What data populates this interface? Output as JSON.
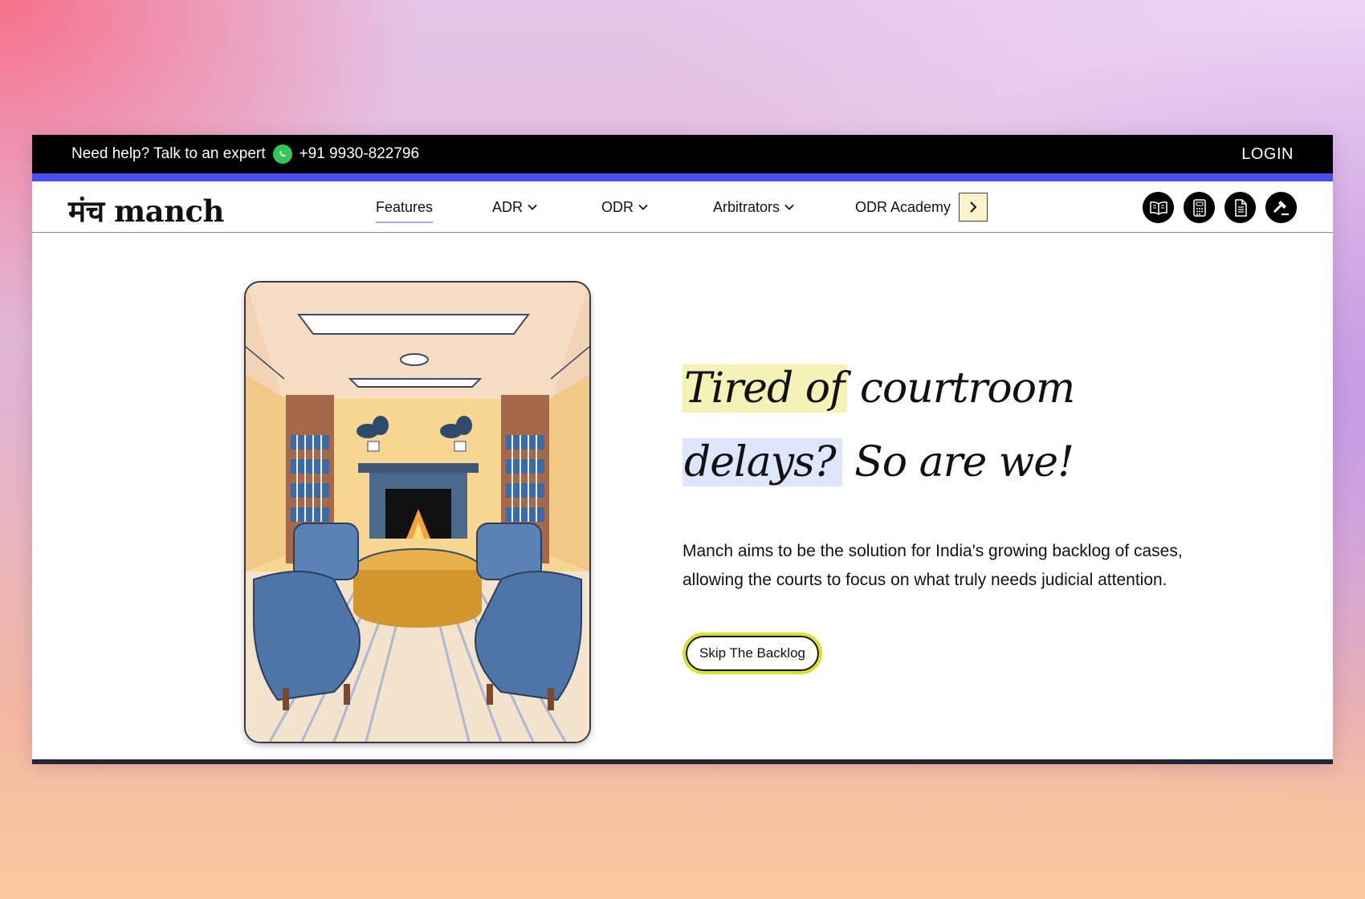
{
  "topbar": {
    "help_text": "Need help? Talk to an expert",
    "phone": "+91 9930-822796",
    "login_label": "LOGIN"
  },
  "nav": {
    "logo_text": "मंच manch",
    "items": [
      {
        "label": "Features"
      },
      {
        "label": "ADR"
      },
      {
        "label": "ODR"
      },
      {
        "label": "Arbitrators"
      },
      {
        "label": "ODR Academy"
      }
    ],
    "icons": [
      "book-icon",
      "calculator-icon",
      "document-icon",
      "gavel-icon"
    ]
  },
  "hero": {
    "headline_highlight_1": "Tired of",
    "headline_rest_1": " courtroom",
    "headline_highlight_2": "delays?",
    "headline_rest_2": " So are we!",
    "description": "Manch aims to be the solution for India's growing backlog of cases, allowing the courts to focus on what truly needs judicial attention.",
    "cta_label": "Skip The Backlog"
  },
  "colors": {
    "accent_blue": "#4a4df0",
    "highlight_yellow": "#f5f2b7",
    "highlight_blue": "#dde6fd",
    "cta_border": "#d9e22b"
  }
}
